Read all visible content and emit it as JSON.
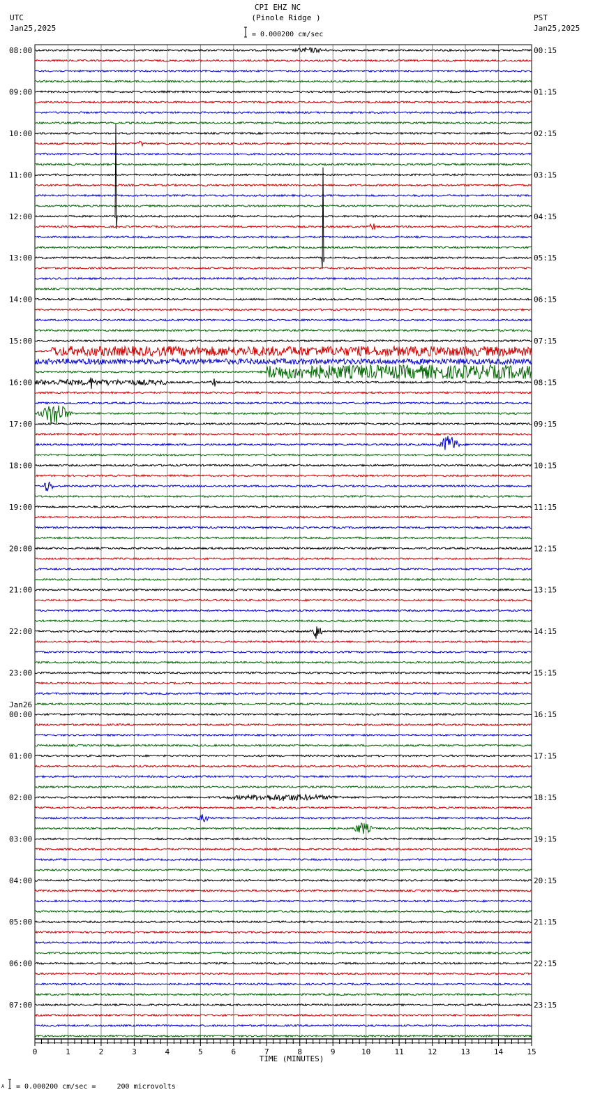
{
  "header": {
    "title": "CPI EHZ NC",
    "subtitle": "(Pinole Ridge )",
    "left_tz": "UTC",
    "left_date": "Jan25,2025",
    "right_tz": "PST",
    "right_date": "Jan25,2025",
    "scale_text": "= 0.000200 cm/sec"
  },
  "footer": {
    "scale_text": "= 0.000200 cm/sec =     200 microvolts",
    "scale_prefix": "A"
  },
  "chart_data": {
    "type": "line",
    "subtype": "helicorder",
    "xlabel": "TIME (MINUTES)",
    "xlim": [
      0,
      15
    ],
    "x_ticks": [
      "0",
      "1",
      "2",
      "3",
      "4",
      "5",
      "6",
      "7",
      "8",
      "9",
      "10",
      "11",
      "12",
      "13",
      "14",
      "15"
    ],
    "traces_per_hour": 4,
    "trace_count": 96,
    "trace_colors": [
      "#000000",
      "#cc0000",
      "#0000cc",
      "#006600"
    ],
    "left_labels": [
      "08:00",
      "09:00",
      "10:00",
      "11:00",
      "12:00",
      "13:00",
      "14:00",
      "15:00",
      "16:00",
      "17:00",
      "18:00",
      "19:00",
      "20:00",
      "21:00",
      "22:00",
      "23:00",
      "00:00",
      "01:00",
      "02:00",
      "03:00",
      "04:00",
      "05:00",
      "06:00",
      "07:00"
    ],
    "date_change_label": {
      "text": "Jan26",
      "before_hour_index": 16
    },
    "right_labels": [
      "00:15",
      "01:15",
      "02:15",
      "03:15",
      "04:15",
      "05:15",
      "06:15",
      "07:15",
      "08:15",
      "09:15",
      "10:15",
      "11:15",
      "12:15",
      "13:15",
      "14:15",
      "15:15",
      "16:15",
      "17:15",
      "18:15",
      "19:15",
      "20:15",
      "21:15",
      "22:15",
      "23:15"
    ],
    "events": [
      {
        "trace": 0,
        "minute": 8.3,
        "amplitude": 4,
        "duration": 1.5
      },
      {
        "trace": 9,
        "minute": 3.2,
        "amplitude": 4,
        "duration": 0.4
      },
      {
        "trace": 17,
        "minute": 10.2,
        "amplitude": 8,
        "duration": 0.2
      },
      {
        "trace": 16,
        "minute": 2.45,
        "amplitude": 160,
        "duration": 0.02
      },
      {
        "trace": 20,
        "minute": 8.7,
        "amplitude": 130,
        "duration": 0.02
      },
      {
        "trace": 32,
        "minute": 1.7,
        "amplitude": 10,
        "duration": 0.2
      },
      {
        "trace": 32,
        "minute": 5.4,
        "amplitude": 8,
        "duration": 0.2
      },
      {
        "trace": 35,
        "minute": 0.6,
        "amplitude": 18,
        "duration": 1.0
      },
      {
        "trace": 38,
        "minute": 12.5,
        "amplitude": 14,
        "duration": 0.7
      },
      {
        "trace": 42,
        "minute": 0.4,
        "amplitude": 9,
        "duration": 0.4
      },
      {
        "trace": 56,
        "minute": 8.5,
        "amplitude": 12,
        "duration": 0.4
      },
      {
        "trace": 72,
        "minute": 7.5,
        "amplitude": 5,
        "duration": 5
      },
      {
        "trace": 74,
        "minute": 5.1,
        "amplitude": 6,
        "duration": 0.5
      },
      {
        "trace": 75,
        "minute": 9.9,
        "amplitude": 9,
        "duration": 0.7
      }
    ],
    "noisy_segments": [
      {
        "trace": 29,
        "from": 0.5,
        "to": 15,
        "amplitude": 7
      },
      {
        "trace": 30,
        "from": 0,
        "to": 15,
        "amplitude": 4
      },
      {
        "trace": 31,
        "from": 7,
        "to": 15,
        "amplitude": 10
      },
      {
        "trace": 32,
        "from": 0,
        "to": 4,
        "amplitude": 4
      }
    ]
  }
}
